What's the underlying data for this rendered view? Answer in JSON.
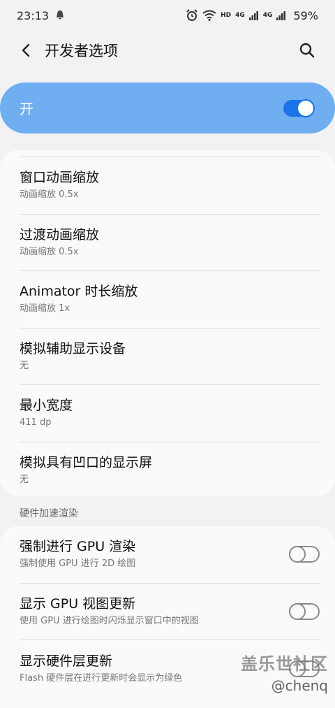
{
  "status_bar": {
    "time": "23:13",
    "network_hd": "HD",
    "network_4g_1": "4G",
    "network_4g_2": "4G",
    "battery": "59%"
  },
  "app_bar": {
    "title": "开发者选项"
  },
  "master_switch": {
    "label": "开",
    "state": "on"
  },
  "animation_settings": [
    {
      "title": "窗口动画缩放",
      "subtitle": "动画缩放 0.5x"
    },
    {
      "title": "过渡动画缩放",
      "subtitle": "动画缩放 0.5x"
    },
    {
      "title": "Animator 时长缩放",
      "subtitle": "动画缩放 1x"
    },
    {
      "title": "模拟辅助显示设备",
      "subtitle": "无"
    },
    {
      "title": "最小宽度",
      "subtitle": "411 dp"
    },
    {
      "title": "模拟具有凹口的显示屏",
      "subtitle": "无"
    }
  ],
  "hardware_section": {
    "header": "硬件加速渲染",
    "items": [
      {
        "title": "强制进行 GPU 渲染",
        "subtitle": "强制使用 GPU 进行 2D 绘图",
        "state": "off"
      },
      {
        "title": "显示 GPU 视图更新",
        "subtitle": "使用 GPU 进行绘图时闪烁显示窗口中的视图",
        "state": "off"
      },
      {
        "title": "显示硬件层更新",
        "subtitle": "Flash 硬件层在进行更新时会显示为绿色",
        "state": "off"
      }
    ]
  },
  "watermark": {
    "line1": "盖乐世社区",
    "line2": "@chenq"
  },
  "colors": {
    "master_switch_bg": "#70aef2",
    "toggle_on": "#1a73e8",
    "background": "#f2f2f2",
    "card": "#fafafa"
  },
  "icons": [
    "alarm-icon",
    "wifi-icon",
    "signal-icon",
    "back-arrow-icon",
    "search-icon"
  ]
}
